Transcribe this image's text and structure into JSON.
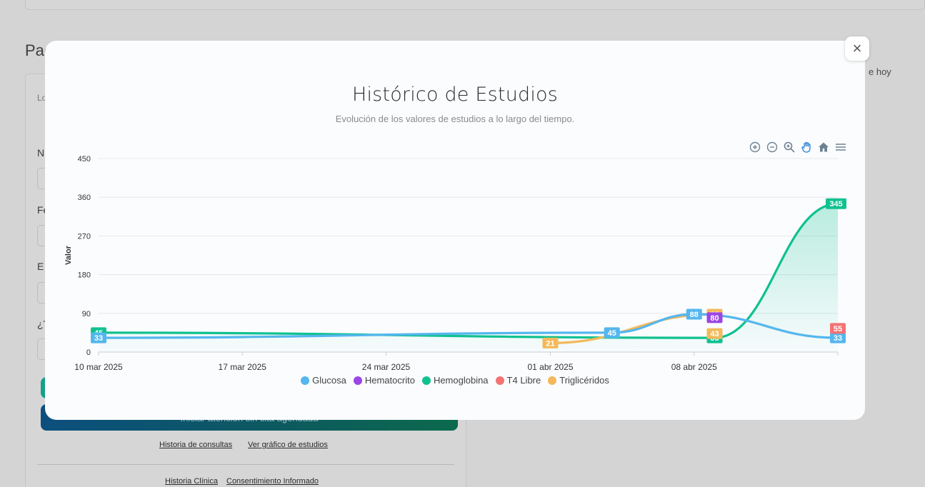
{
  "background": {
    "section_title": "Pac",
    "right_text": "e hoy",
    "label_1": "Lo",
    "label_2": "N",
    "label_3": "Fe",
    "label_4": "E",
    "label_5": "¿T",
    "start_button": "Iniciar atención sin cita agendada",
    "link_history": "Historia de consultas",
    "link_studies_chart": "Ver gráfico de estudios",
    "link_clinical": "Historia Clínica",
    "link_consent": "Consentimiento Informado"
  },
  "modal": {
    "close_label": "×"
  },
  "chart_data": {
    "type": "line",
    "title": "Histórico de Estudios",
    "subtitle": "Evolución de los valores de estudios a lo largo del tiempo.",
    "ylabel": "Valor",
    "xlabel": "",
    "ylim": [
      0,
      450
    ],
    "yticks": [
      "0",
      "90",
      "180",
      "270",
      "360",
      "450"
    ],
    "xticks": [
      "10 mar 2025",
      "17 mar 2025",
      "24 mar 2025",
      "01 abr 2025",
      "08 abr 2025"
    ],
    "xtick_dates": [
      "2025-03-10",
      "2025-03-17",
      "2025-03-24",
      "2025-04-01",
      "2025-04-08"
    ],
    "xlim": [
      "2025-03-10",
      "2025-04-15"
    ],
    "grid": true,
    "legend_position": "bottom",
    "series": [
      {
        "name": "Glucosa",
        "color": "#54b6ee",
        "points": [
          {
            "x": "2025-03-10",
            "y": 33,
            "label": "33"
          },
          {
            "x": "2025-04-04",
            "y": 45,
            "label": "45"
          },
          {
            "x": "2025-04-08",
            "y": 88,
            "label": "88"
          },
          {
            "x": "2025-04-15",
            "y": 33,
            "label": "33"
          }
        ]
      },
      {
        "name": "Hematocrito",
        "color": "#9b46e4",
        "points": [
          {
            "x": "2025-04-09",
            "y": 80,
            "label": "80"
          }
        ]
      },
      {
        "name": "Hemoglobina",
        "color": "#10c190",
        "area": true,
        "points": [
          {
            "x": "2025-03-10",
            "y": 45,
            "label": "45"
          },
          {
            "x": "2025-04-09",
            "y": 33,
            "label": "33"
          },
          {
            "x": "2025-04-15",
            "y": 345,
            "label": "345"
          }
        ]
      },
      {
        "name": "T4 Libre",
        "color": "#f47373",
        "points": [
          {
            "x": "2025-04-15",
            "y": 55,
            "label": "55"
          }
        ]
      },
      {
        "name": "Triglicéridos",
        "color": "#f3b95b",
        "points": [
          {
            "x": "2025-04-01",
            "y": 21,
            "label": "21"
          },
          {
            "x": "2025-04-09",
            "y": 88,
            "label": "88"
          },
          {
            "x": "2025-04-09",
            "y": 43,
            "label": "43"
          }
        ]
      }
    ]
  },
  "toolbar": {
    "icons": [
      "zoom-in-icon",
      "zoom-out-icon",
      "zoom-select-icon",
      "pan-hand-icon",
      "home-icon",
      "menu-icon"
    ]
  }
}
